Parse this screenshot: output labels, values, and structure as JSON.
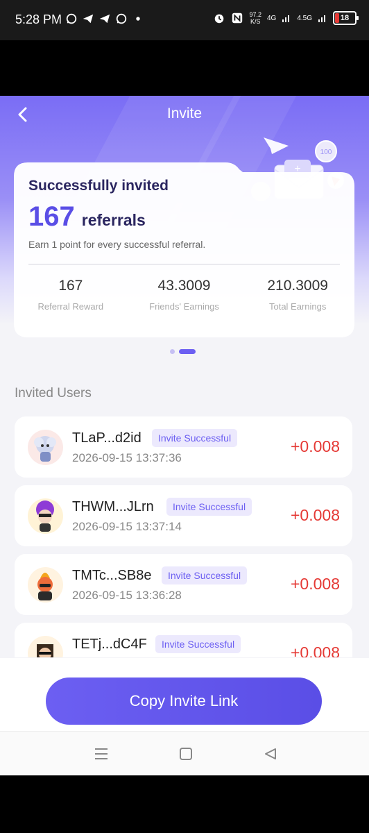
{
  "status_bar": {
    "time": "5:28 PM",
    "speed_value": "97.2",
    "speed_unit": "K/S",
    "network_1": "4G",
    "network_2": "4.5G",
    "battery": "18"
  },
  "nav": {
    "title": "Invite"
  },
  "summary": {
    "title": "Successfully invited",
    "count": "167",
    "count_label": "referrals",
    "description": "Earn 1 point for every successful referral.",
    "stats": [
      {
        "value": "167",
        "label": "Referral Reward"
      },
      {
        "value": "43.3009",
        "label": "Friends' Earnings"
      },
      {
        "value": "210.3009",
        "label": "Total Earnings"
      }
    ],
    "illustration_coin": "100"
  },
  "section_title": "Invited Users",
  "users": [
    {
      "name": "TLaP...d2id",
      "badge": "Invite Successful",
      "date": "2026-09-15 13:37:36",
      "amount": "+0.008"
    },
    {
      "name": "THWM...JLrn",
      "badge": "Invite Successful",
      "date": "2026-09-15 13:37:14",
      "amount": "+0.008"
    },
    {
      "name": "TMTc...SB8e",
      "badge": "Invite Successful",
      "date": "2026-09-15 13:36:28",
      "amount": "+0.008"
    },
    {
      "name": "TETj...dC4F",
      "badge": "Invite Successful",
      "date": "",
      "amount": "+0.008"
    }
  ],
  "copy_button": "Copy Invite Link",
  "colors": {
    "accent": "#6c5ff2",
    "amount": "#e53935",
    "header": "#7a6df5"
  }
}
